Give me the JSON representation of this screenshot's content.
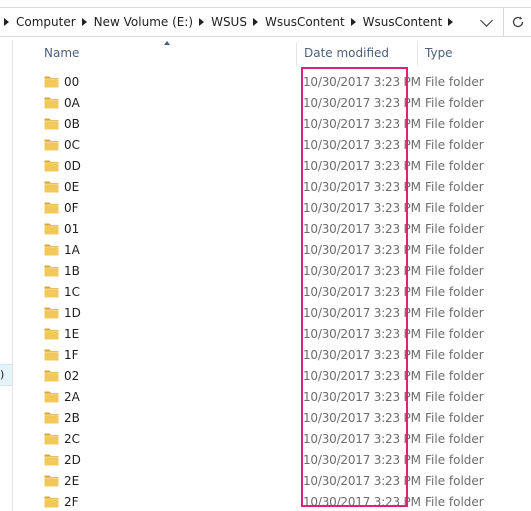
{
  "breadcrumb": {
    "items": [
      "Computer",
      "New Volume (E:)",
      "WSUS",
      "WsusContent",
      "WsusContent"
    ]
  },
  "navpane": {
    "selected_fragment": ")"
  },
  "columns": {
    "name": "Name",
    "date_modified": "Date modified",
    "type": "Type",
    "sort_column": "Name",
    "sort_direction": "ascending"
  },
  "rows": [
    {
      "name": "00",
      "date": "10/30/2017 3:23 PM",
      "type": "File folder"
    },
    {
      "name": "0A",
      "date": "10/30/2017 3:23 PM",
      "type": "File folder"
    },
    {
      "name": "0B",
      "date": "10/30/2017 3:23 PM",
      "type": "File folder"
    },
    {
      "name": "0C",
      "date": "10/30/2017 3:23 PM",
      "type": "File folder"
    },
    {
      "name": "0D",
      "date": "10/30/2017 3:23 PM",
      "type": "File folder"
    },
    {
      "name": "0E",
      "date": "10/30/2017 3:23 PM",
      "type": "File folder"
    },
    {
      "name": "0F",
      "date": "10/30/2017 3:23 PM",
      "type": "File folder"
    },
    {
      "name": "01",
      "date": "10/30/2017 3:23 PM",
      "type": "File folder"
    },
    {
      "name": "1A",
      "date": "10/30/2017 3:23 PM",
      "type": "File folder"
    },
    {
      "name": "1B",
      "date": "10/30/2017 3:23 PM",
      "type": "File folder"
    },
    {
      "name": "1C",
      "date": "10/30/2017 3:23 PM",
      "type": "File folder"
    },
    {
      "name": "1D",
      "date": "10/30/2017 3:23 PM",
      "type": "File folder"
    },
    {
      "name": "1E",
      "date": "10/30/2017 3:23 PM",
      "type": "File folder"
    },
    {
      "name": "1F",
      "date": "10/30/2017 3:23 PM",
      "type": "File folder"
    },
    {
      "name": "02",
      "date": "10/30/2017 3:23 PM",
      "type": "File folder"
    },
    {
      "name": "2A",
      "date": "10/30/2017 3:23 PM",
      "type": "File folder"
    },
    {
      "name": "2B",
      "date": "10/30/2017 3:23 PM",
      "type": "File folder"
    },
    {
      "name": "2C",
      "date": "10/30/2017 3:23 PM",
      "type": "File folder"
    },
    {
      "name": "2D",
      "date": "10/30/2017 3:23 PM",
      "type": "File folder"
    },
    {
      "name": "2E",
      "date": "10/30/2017 3:23 PM",
      "type": "File folder"
    },
    {
      "name": "2F",
      "date": "10/30/2017 3:23 PM",
      "type": "File folder"
    }
  ],
  "icons": {
    "folder": "folder-icon",
    "breadcrumb_separator": "chevron-right-icon",
    "address_dropdown": "chevron-down-icon",
    "refresh": "refresh-icon"
  },
  "colors": {
    "highlight": "#e0207a",
    "folder_fill": "#f1c85b",
    "folder_tab": "#d9a935",
    "header_text": "#4c607a"
  }
}
